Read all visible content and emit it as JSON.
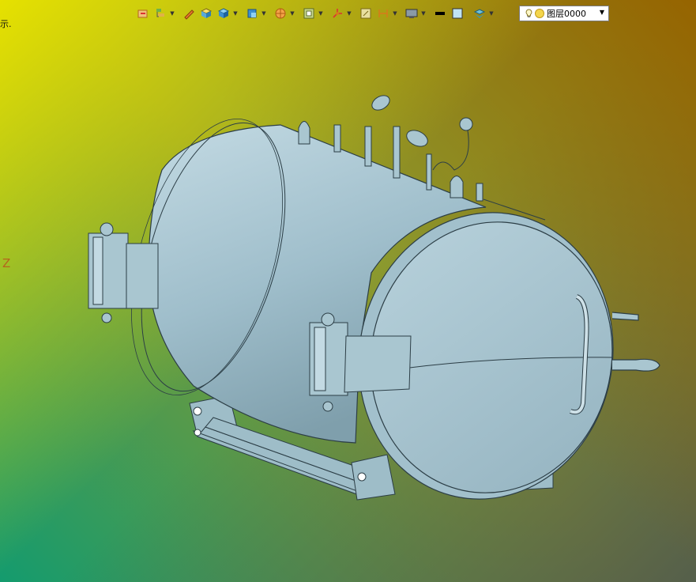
{
  "app": {
    "left_partial_text": "示.",
    "axis_label": "Z"
  },
  "toolbar": {
    "items": [
      {
        "icon": "open-folder-icon",
        "has_menu": false
      },
      {
        "icon": "layers-tree-icon",
        "has_menu": true
      },
      {
        "icon": "pencil-icon",
        "has_menu": false
      },
      {
        "icon": "cube-yellow-icon",
        "has_menu": false
      },
      {
        "icon": "cube-blue-icon",
        "has_menu": true
      },
      {
        "icon": "cube-view-icon",
        "has_menu": true
      },
      {
        "icon": "sphere-section-icon",
        "has_menu": true
      },
      {
        "icon": "frame-icon",
        "has_menu": true
      },
      {
        "icon": "axis-triad-icon",
        "has_menu": true
      },
      {
        "icon": "zoom-box-icon",
        "has_menu": false
      },
      {
        "icon": "dimension-icon",
        "has_menu": true
      },
      {
        "icon": "monitor-icon",
        "has_menu": true
      },
      {
        "icon": "line-black-icon",
        "has_menu": false
      },
      {
        "icon": "color-swatch-icon",
        "has_menu": false
      },
      {
        "icon": "layer-stack-icon",
        "has_menu": true
      }
    ],
    "layer_select": {
      "value": "图层0000"
    }
  },
  "colors": {
    "model_fill": "#a9c6d0",
    "model_edge": "#2c3e46",
    "toolbar_accent": "#d87a1a"
  }
}
